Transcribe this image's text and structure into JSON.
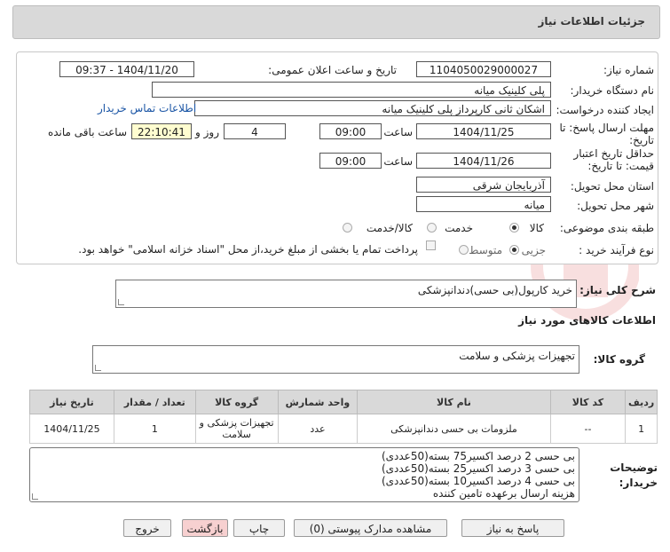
{
  "page_title": "جزئیات اطلاعات نیاز",
  "fields": {
    "need_number_label": "شماره نیاز:",
    "need_number": "1104050029000027",
    "announce_label": "تاریخ و ساعت اعلان عمومی:",
    "announce_value": "1404/11/20 - 09:37",
    "buyer_org_label": "نام دستگاه خریدار:",
    "buyer_org": "پلی کلینیک میانه",
    "creator_label": "ایجاد کننده درخواست:",
    "creator": "اشکان ثانی کارپرداز پلی کلینیک میانه",
    "contact_link": "اطلاعات تماس خریدار",
    "reply_deadline_label": "مهلت ارسال پاسخ: تا تاریخ:",
    "reply_date": "1404/11/25",
    "time_label": "ساعت",
    "reply_time": "09:00",
    "day_and_label": "روز و",
    "days_value": "4",
    "remaining_time": "22:10:41",
    "remaining_label": "ساعت باقی مانده",
    "price_validity_label": "حداقل تاریخ اعتبار قیمت: تا تاریخ:",
    "price_date": "1404/11/26",
    "price_time": "09:00",
    "province_label": "استان محل تحویل:",
    "province": "آذربایجان شرقی",
    "city_label": "شهر محل تحویل:",
    "city": "میانه",
    "category_label": "طبقه بندی موضوعی:",
    "category_options": [
      "کالا",
      "خدمت",
      "کالا/خدمت"
    ],
    "process_label": "نوع فرآیند خرید :",
    "process_options": [
      "جزیی",
      "متوسط"
    ],
    "payment_note": "پرداخت تمام یا بخشی از مبلغ خرید،از محل \"اسناد خزانه اسلامی\" خواهد بود."
  },
  "description": {
    "label": "شرح کلی نیاز:",
    "value": "خرید کارپول(بی حسی)دندانپزشکی"
  },
  "goods_section_title": "اطلاعات کالاهای مورد نیاز",
  "goods_group": {
    "label": "گروه کالا:",
    "value": "تجهیزات پزشکی و سلامت"
  },
  "table": {
    "headers": [
      "ردیف",
      "کد کالا",
      "نام کالا",
      "واحد شمارش",
      "گروه کالا",
      "تعداد / مقدار",
      "تاریخ نیاز"
    ],
    "rows": [
      [
        "1",
        "--",
        "ملزومات بی حسی دندانپزشکی",
        "عدد",
        "تجهیزات پزشکی و سلامت",
        "1",
        "1404/11/25"
      ]
    ]
  },
  "buyer_notes": {
    "label": "توضیحات خریدار:",
    "lines": [
      "بی حسی 2 درصد  اکسیر75 بسته(50عددی)",
      "بی حسی 3 درصد  اکسیر25 بسته(50عددی)",
      "بی حسی 4 درصد  اکسیر10 بسته(50عددی)",
      "هزینه ارسال برعهده تامین کننده"
    ]
  },
  "buttons": {
    "reply": "پاسخ به نیاز",
    "attachments": "مشاهده مدارک پیوستی (0)",
    "print": "چاپ",
    "back": "بازگشت",
    "exit": "خروج"
  },
  "colors": {
    "header_bg": "#d9d9d9",
    "highlight_box": "#fffdd0",
    "link": "#1a55a5",
    "back_button_bg": "#f7d0d0"
  }
}
